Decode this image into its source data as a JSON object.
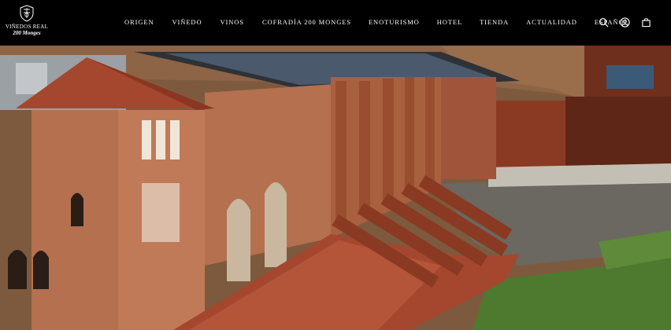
{
  "brand": {
    "line1": "VIÑEDOS REAL",
    "line2": "200 Monges",
    "crest_icon": "crest-icon"
  },
  "nav": {
    "items": [
      {
        "label": "ORIGEN"
      },
      {
        "label": "VIÑEDO"
      },
      {
        "label": "VINOS"
      },
      {
        "label": "COFRADÍA 200 MONGES"
      },
      {
        "label": "ENOTURISMO"
      },
      {
        "label": "HOTEL"
      },
      {
        "label": "TIENDA"
      },
      {
        "label": "ACTUALIDAD"
      },
      {
        "label": "ESPAÑOL"
      }
    ]
  },
  "toolbar": {
    "icons": [
      "search-icon",
      "account-icon",
      "cart-icon"
    ]
  },
  "colors": {
    "header_bg": "#000000",
    "nav_text": "#ffffff",
    "brick": "#b5704f",
    "roof_tile": "#a4472e",
    "corten_steel": "#8a3a22",
    "grass": "#4d7a2e"
  }
}
